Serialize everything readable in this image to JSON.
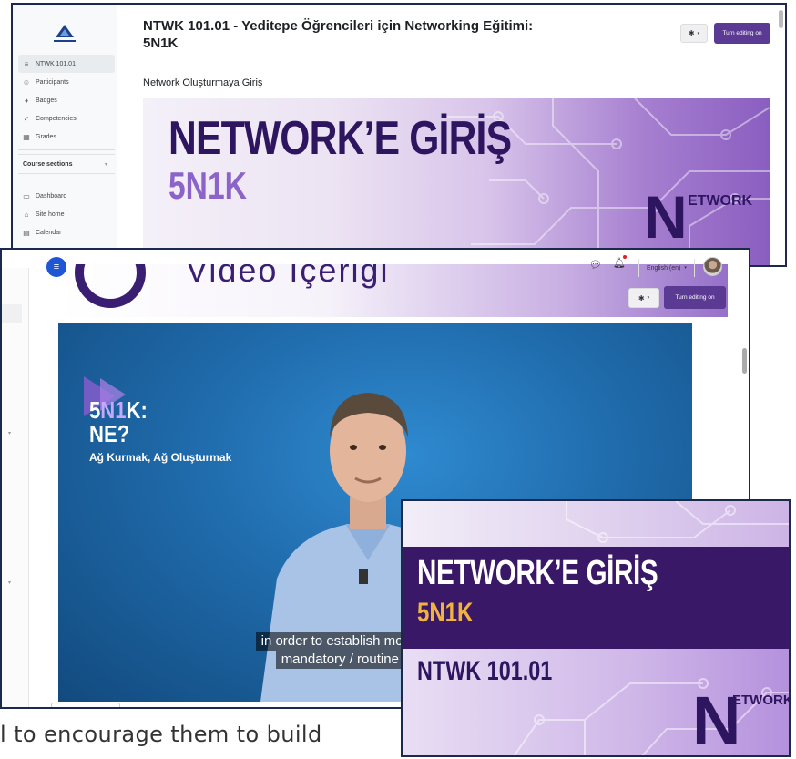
{
  "window1": {
    "course_title": "NTWK 101.01 - Yeditepe Öğrencileri için Networking Eğitimi: 5N1K",
    "section_subtitle": "Network Oluşturmaya Giriş",
    "edit_button": "Turn editing on",
    "sidebar": {
      "items": [
        {
          "label": "NTWK 101.01",
          "icon": "course-icon"
        },
        {
          "label": "Participants",
          "icon": "users-icon"
        },
        {
          "label": "Badges",
          "icon": "badge-icon"
        },
        {
          "label": "Competencies",
          "icon": "check-icon"
        },
        {
          "label": "Grades",
          "icon": "table-icon"
        }
      ],
      "sections_label": "Course sections",
      "items2": [
        {
          "label": "Dashboard",
          "icon": "dashboard-icon"
        },
        {
          "label": "Site home",
          "icon": "home-icon"
        },
        {
          "label": "Calendar",
          "icon": "calendar-icon"
        }
      ]
    },
    "banner": {
      "title": "NETWORK’E GİRİŞ",
      "subtitle": "5N1K",
      "logo_n": "N",
      "logo_rest": "ETWORK"
    }
  },
  "window2": {
    "language": "English (en)",
    "header_text": "Video İçeriği",
    "edit_button": "Turn editing on",
    "video": {
      "tag_line1_a": "5",
      "tag_line1_b": "N1",
      "tag_line1_c": "K:",
      "tag_line2": "NE?",
      "tag_line3": "Ağ Kurmak, Ağ Oluşturmak",
      "caption_line1": "in order to establish more producti",
      "caption_line2": "mandatory / routine encoun"
    }
  },
  "window3": {
    "title": "NETWORK’E GİRİŞ",
    "subtitle": "5N1K",
    "course_code": "NTWK 101.01",
    "logo_n": "N",
    "logo_rest": "ETWORK"
  },
  "bottom_fragment": "l to encourage them to build",
  "colors": {
    "brand_purple": "#5b3a94",
    "deep_purple": "#2e1560",
    "accent_gold": "#f0b33e",
    "menu_blue": "#1e56d6"
  }
}
